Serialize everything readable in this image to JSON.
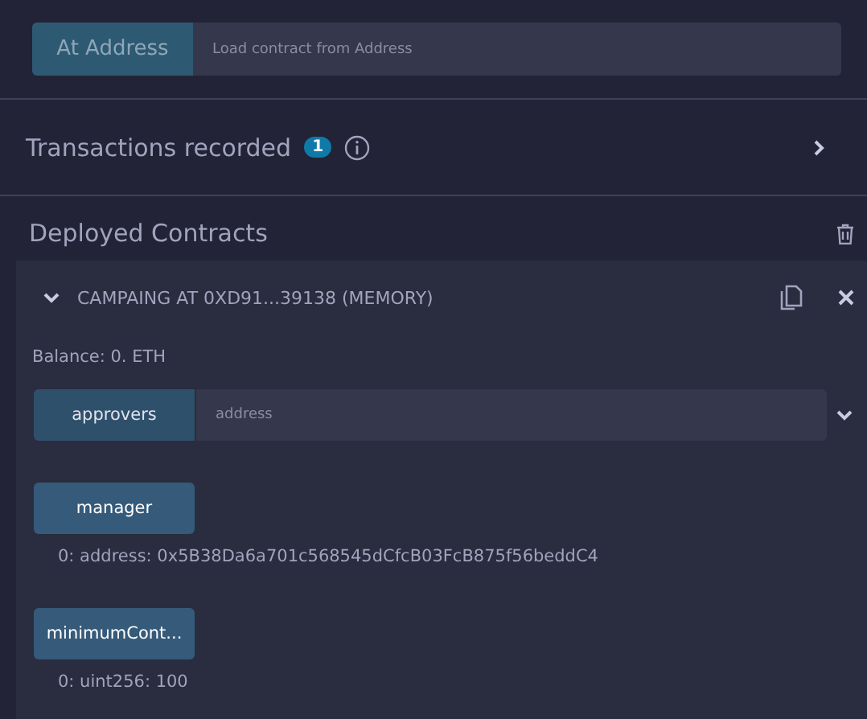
{
  "at_address": {
    "button": "At Address",
    "placeholder": "Load contract from Address"
  },
  "transactions": {
    "label": "Transactions recorded",
    "count": "1",
    "expanded": false
  },
  "deployed": {
    "title": "Deployed Contracts",
    "contract": {
      "title": "CAMPAING AT 0XD91...39138 (MEMORY)",
      "expanded": true,
      "balance": "Balance: 0. ETH",
      "functions": [
        {
          "kind": "input",
          "label": "approvers",
          "placeholder": "address"
        },
        {
          "kind": "plain",
          "label": "manager",
          "result": "0: address: 0x5B38Da6a701c568545dCfcB03FcB875f56beddC4"
        },
        {
          "kind": "plain",
          "label": "minimumCont...",
          "result": "0: uint256: 100"
        }
      ]
    }
  }
}
